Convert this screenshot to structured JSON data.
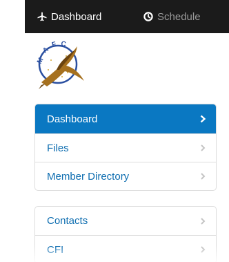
{
  "topnav": {
    "items": [
      {
        "label": "Dashboard",
        "icon": "plane-icon",
        "active": true
      },
      {
        "label": "Schedule",
        "icon": "clock-icon",
        "active": false
      }
    ]
  },
  "logo": {
    "text": "MAFC",
    "icon": "pheasant-emblem"
  },
  "sidebar": {
    "group1": [
      {
        "label": "Dashboard",
        "active": true
      },
      {
        "label": "Files",
        "active": false
      },
      {
        "label": "Member Directory",
        "active": false
      }
    ],
    "group2": [
      {
        "label": "Contacts",
        "active": false
      },
      {
        "label": "CFI",
        "active": false
      }
    ]
  },
  "colors": {
    "topbar": "#1b1b1b",
    "accent": "#0a78c2",
    "link": "#0d6db0",
    "border": "#dddddd"
  }
}
